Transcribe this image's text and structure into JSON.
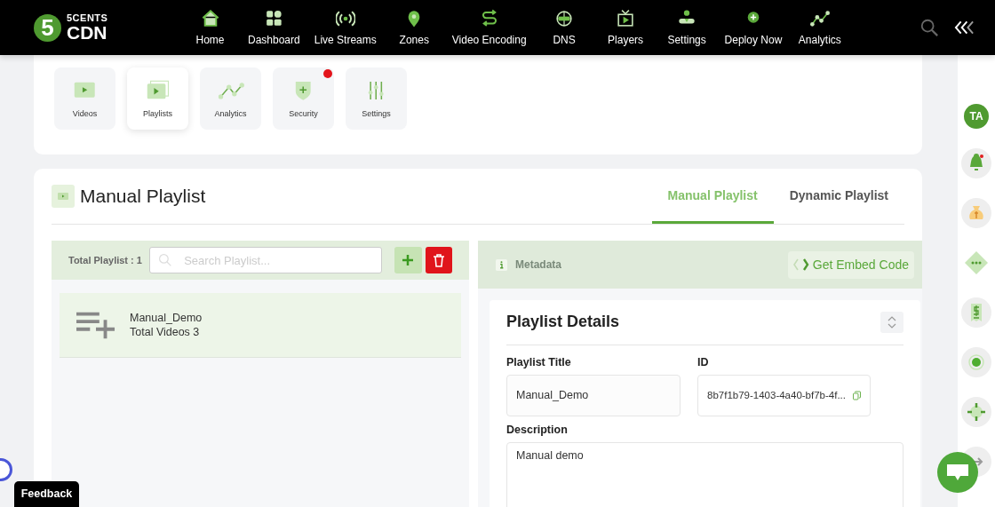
{
  "logo": {
    "top": "5CENTS",
    "bottom": "CDN",
    "badge": "5"
  },
  "nav": [
    {
      "label": "Home"
    },
    {
      "label": "Dashboard"
    },
    {
      "label": "Live Streams"
    },
    {
      "label": "Zones"
    },
    {
      "label": "Video Encoding"
    },
    {
      "label": "DNS"
    },
    {
      "label": "Players"
    },
    {
      "label": "Settings"
    },
    {
      "label": "Deploy Now"
    },
    {
      "label": "Analytics"
    }
  ],
  "tiles": [
    {
      "label": "Videos",
      "selected": false,
      "alert": false
    },
    {
      "label": "Playlists",
      "selected": true,
      "alert": false
    },
    {
      "label": "Analytics",
      "selected": false,
      "alert": false
    },
    {
      "label": "Security",
      "selected": false,
      "alert": true
    },
    {
      "label": "Settings",
      "selected": false,
      "alert": false
    }
  ],
  "page_title": "Manual Playlist",
  "tabs": [
    {
      "label": "Manual Playlist",
      "selected": true
    },
    {
      "label": "Dynamic Playlist",
      "selected": false
    }
  ],
  "playlist_panel": {
    "total": "Total Playlist : 1",
    "search_placeholder": "Search Playlist...",
    "items": [
      {
        "name": "Manual_Demo",
        "count": "Total Videos 3",
        "selected": true
      }
    ]
  },
  "metadata_bar": {
    "label": "Metadata",
    "embed_button": "Get Embed Code"
  },
  "details": {
    "title": "Playlist Details",
    "title_label": "Playlist Title",
    "title_value": "Manual_Demo",
    "id_label": "ID",
    "id_value": "8b7f1b79-1403-4a40-bf7b-4f...",
    "description_label": "Description",
    "description_value": "Manual demo"
  },
  "avatar": "TA",
  "feedback": "Feedback"
}
